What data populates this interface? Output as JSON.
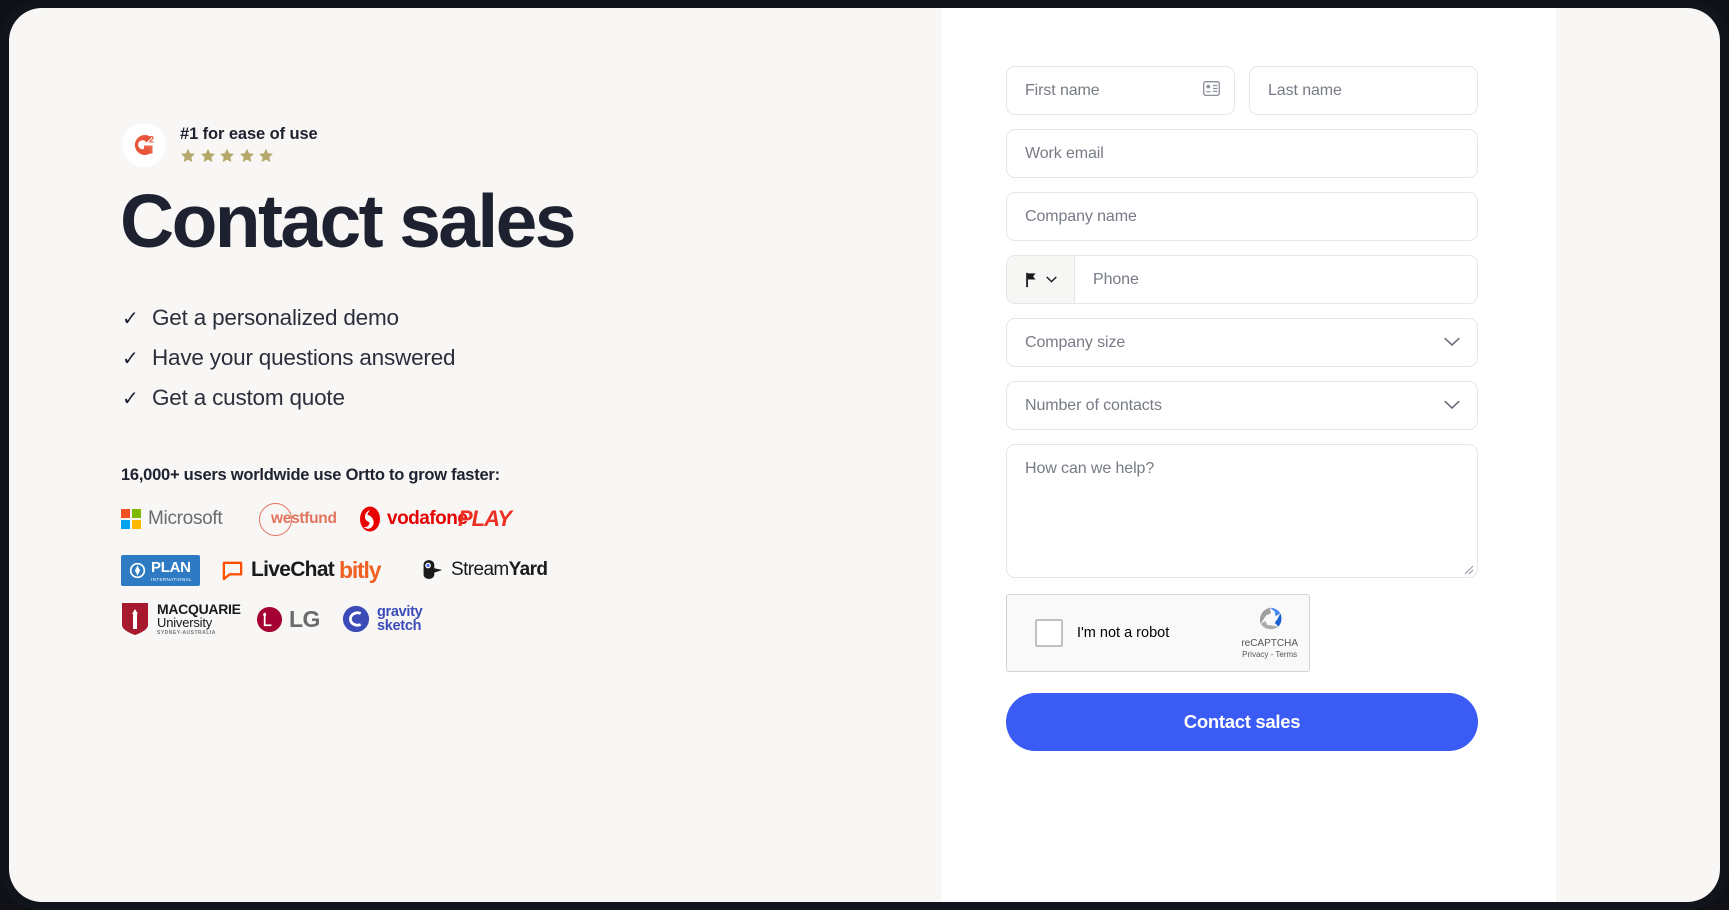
{
  "theme": {
    "page_background": "#F8F7F5",
    "panel_background": "#FFFFFF",
    "frame_color": "#11141A",
    "heading_color": "#1E2230",
    "accent_button": "#3B5BF5",
    "placeholder_color": "#767B85",
    "field_border": "#E6E6E6",
    "star_color": "#B5A86A",
    "g2_red": "#E8553A"
  },
  "hero": {
    "badge": {
      "logo_text": "G2",
      "logo_superscript": "2",
      "rating_text": "#1 for ease of use",
      "star_count": 5,
      "icon": "g2-logo-icon"
    },
    "headline": "Contact sales",
    "checklist": [
      {
        "check": "✓",
        "label": "Get a personalized demo"
      },
      {
        "check": "✓",
        "label": "Have your questions answered"
      },
      {
        "check": "✓",
        "label": "Get a custom quote"
      }
    ],
    "social_proof_title": "16,000+ users worldwide use Ortto to grow faster:",
    "logo_rows": [
      [
        {
          "name": "Microsoft",
          "id": "microsoft-logo"
        },
        {
          "name": "westfund",
          "id": "westfund-logo"
        },
        {
          "name": "vodafone",
          "id": "vodafone-logo"
        },
        {
          "name": "PLAY",
          "id": "play-logo"
        }
      ],
      [
        {
          "name": "PLAN",
          "sub": "INTERNATIONAL",
          "id": "plan-international-logo"
        },
        {
          "name": "LiveChat",
          "id": "livechat-logo"
        },
        {
          "name": "bitly",
          "id": "bitly-logo"
        },
        {
          "name": "StreamYard",
          "name_bold": "Yard",
          "name_light": "Stream",
          "id": "streamyard-logo"
        }
      ],
      [
        {
          "name": "MACQUARIE",
          "line2": "University",
          "line3": "SYDNEY-AUSTRALIA",
          "id": "macquarie-university-logo"
        },
        {
          "name": "LG",
          "id": "lg-logo"
        },
        {
          "name": "gravity",
          "line2": "sketch",
          "id": "gravity-sketch-logo"
        }
      ]
    ]
  },
  "form": {
    "first_name": {
      "placeholder": "First name",
      "value": ""
    },
    "last_name": {
      "placeholder": "Last name",
      "value": ""
    },
    "work_email": {
      "placeholder": "Work email",
      "value": ""
    },
    "company_name": {
      "placeholder": "Company name",
      "value": ""
    },
    "phone": {
      "placeholder": "Phone",
      "value": "",
      "country_icon": "flag-icon"
    },
    "company_size": {
      "placeholder": "Company size",
      "value": ""
    },
    "number_of_contacts": {
      "placeholder": "Number of contacts",
      "value": ""
    },
    "message": {
      "placeholder": "How can we help?",
      "value": ""
    },
    "recaptcha": {
      "label": "I'm not a robot",
      "brand": "reCAPTCHA",
      "legal": "Privacy - Terms",
      "checked": false
    },
    "submit_label": "Contact sales"
  }
}
